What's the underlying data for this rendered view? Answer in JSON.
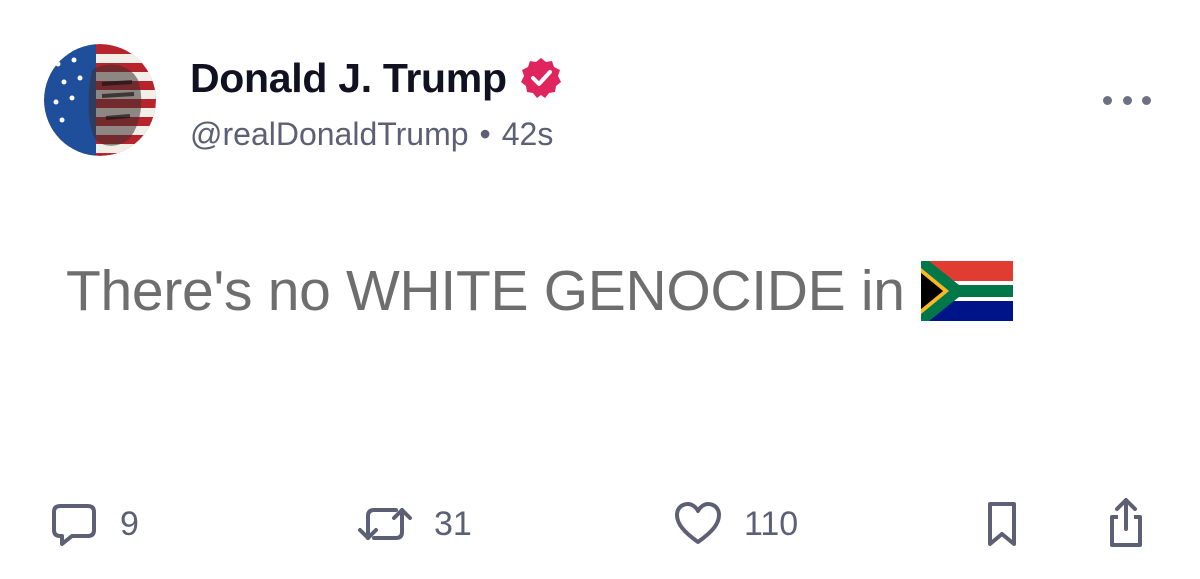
{
  "post": {
    "author": {
      "display_name": "Donald J. Trump",
      "handle": "@realDonaldTrump",
      "verified": true,
      "verified_badge_color": "#e0245e"
    },
    "separator": "•",
    "timestamp": "42s",
    "text": "There's no WHITE GENOCIDE in",
    "emoji_icon": "south-africa-flag-icon"
  },
  "actions": {
    "replies": {
      "icon": "reply-icon",
      "count": "9"
    },
    "reposts": {
      "icon": "repost-icon",
      "count": "31"
    },
    "likes": {
      "icon": "heart-icon",
      "count": "110"
    },
    "bookmark": {
      "icon": "bookmark-icon"
    },
    "share": {
      "icon": "share-icon"
    }
  },
  "colors": {
    "name": "#111122",
    "meta": "#5d6075",
    "body_text": "#6e6e6e",
    "icon": "#5d6075"
  }
}
